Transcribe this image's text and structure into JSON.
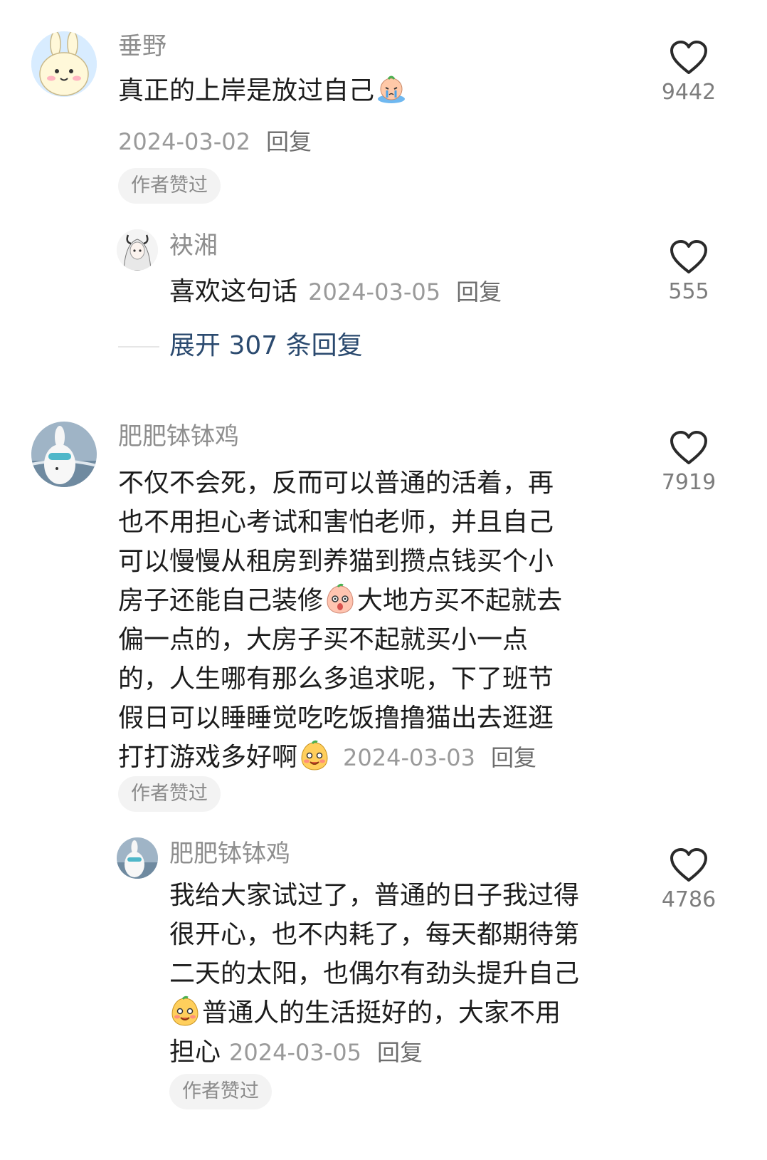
{
  "comments": [
    {
      "username": "垂野",
      "lines": [
        "真正的上岸是放过自己"
      ],
      "date": "2024-03-02",
      "reply_label": "回复",
      "badge": "作者赞过",
      "likes": "9442"
    },
    {
      "username": "肥肥钵钵鸡",
      "lines": [
        "不仅不会死，反而可以普通的活着，再",
        "也不用担心考试和害怕老师，并且自己",
        "可以慢慢从租房到养猫到攒点钱买个小",
        "房子还能自己装修",
        "大地方买不起就去",
        "偏一点的，大房子买不起就买小一点",
        "的，人生哪有那么多追求呢，下了班节",
        "假日可以睡睡觉吃吃饭撸撸猫出去逛逛",
        "打打游戏多好啊"
      ],
      "date": "2024-03-03",
      "reply_label": "回复",
      "badge": "作者赞过",
      "likes": "7919"
    }
  ],
  "replies": [
    {
      "username": "袂湘",
      "text": "喜欢这句话",
      "date": "2024-03-05",
      "reply_label": "回复",
      "likes": "555"
    },
    {
      "username": "肥肥钵钵鸡",
      "lines": [
        "我给大家试过了，普通的日子我过得",
        "很开心，也不内耗了，每天都期待第",
        "二天的太阳，也偶尔有劲头提升自己",
        "普通人的生活挺好的，大家不用",
        "担心"
      ],
      "date": "2024-03-05",
      "reply_label": "回复",
      "badge": "作者赞过",
      "likes": "4786"
    }
  ],
  "expand_replies": "展开 307 条回复",
  "colors": {
    "username": "#8e8e8e",
    "meta": "#9a9a9a",
    "expand_link": "#2b4a6f",
    "badge_bg": "#f3f3f3"
  },
  "icons": {
    "like": "heart-outline-icon",
    "emoji_crying": "crying-emoji-icon",
    "emoji_shocked": "shocked-peach-emoji-icon",
    "emoji_smile": "smiling-emoji-icon"
  }
}
